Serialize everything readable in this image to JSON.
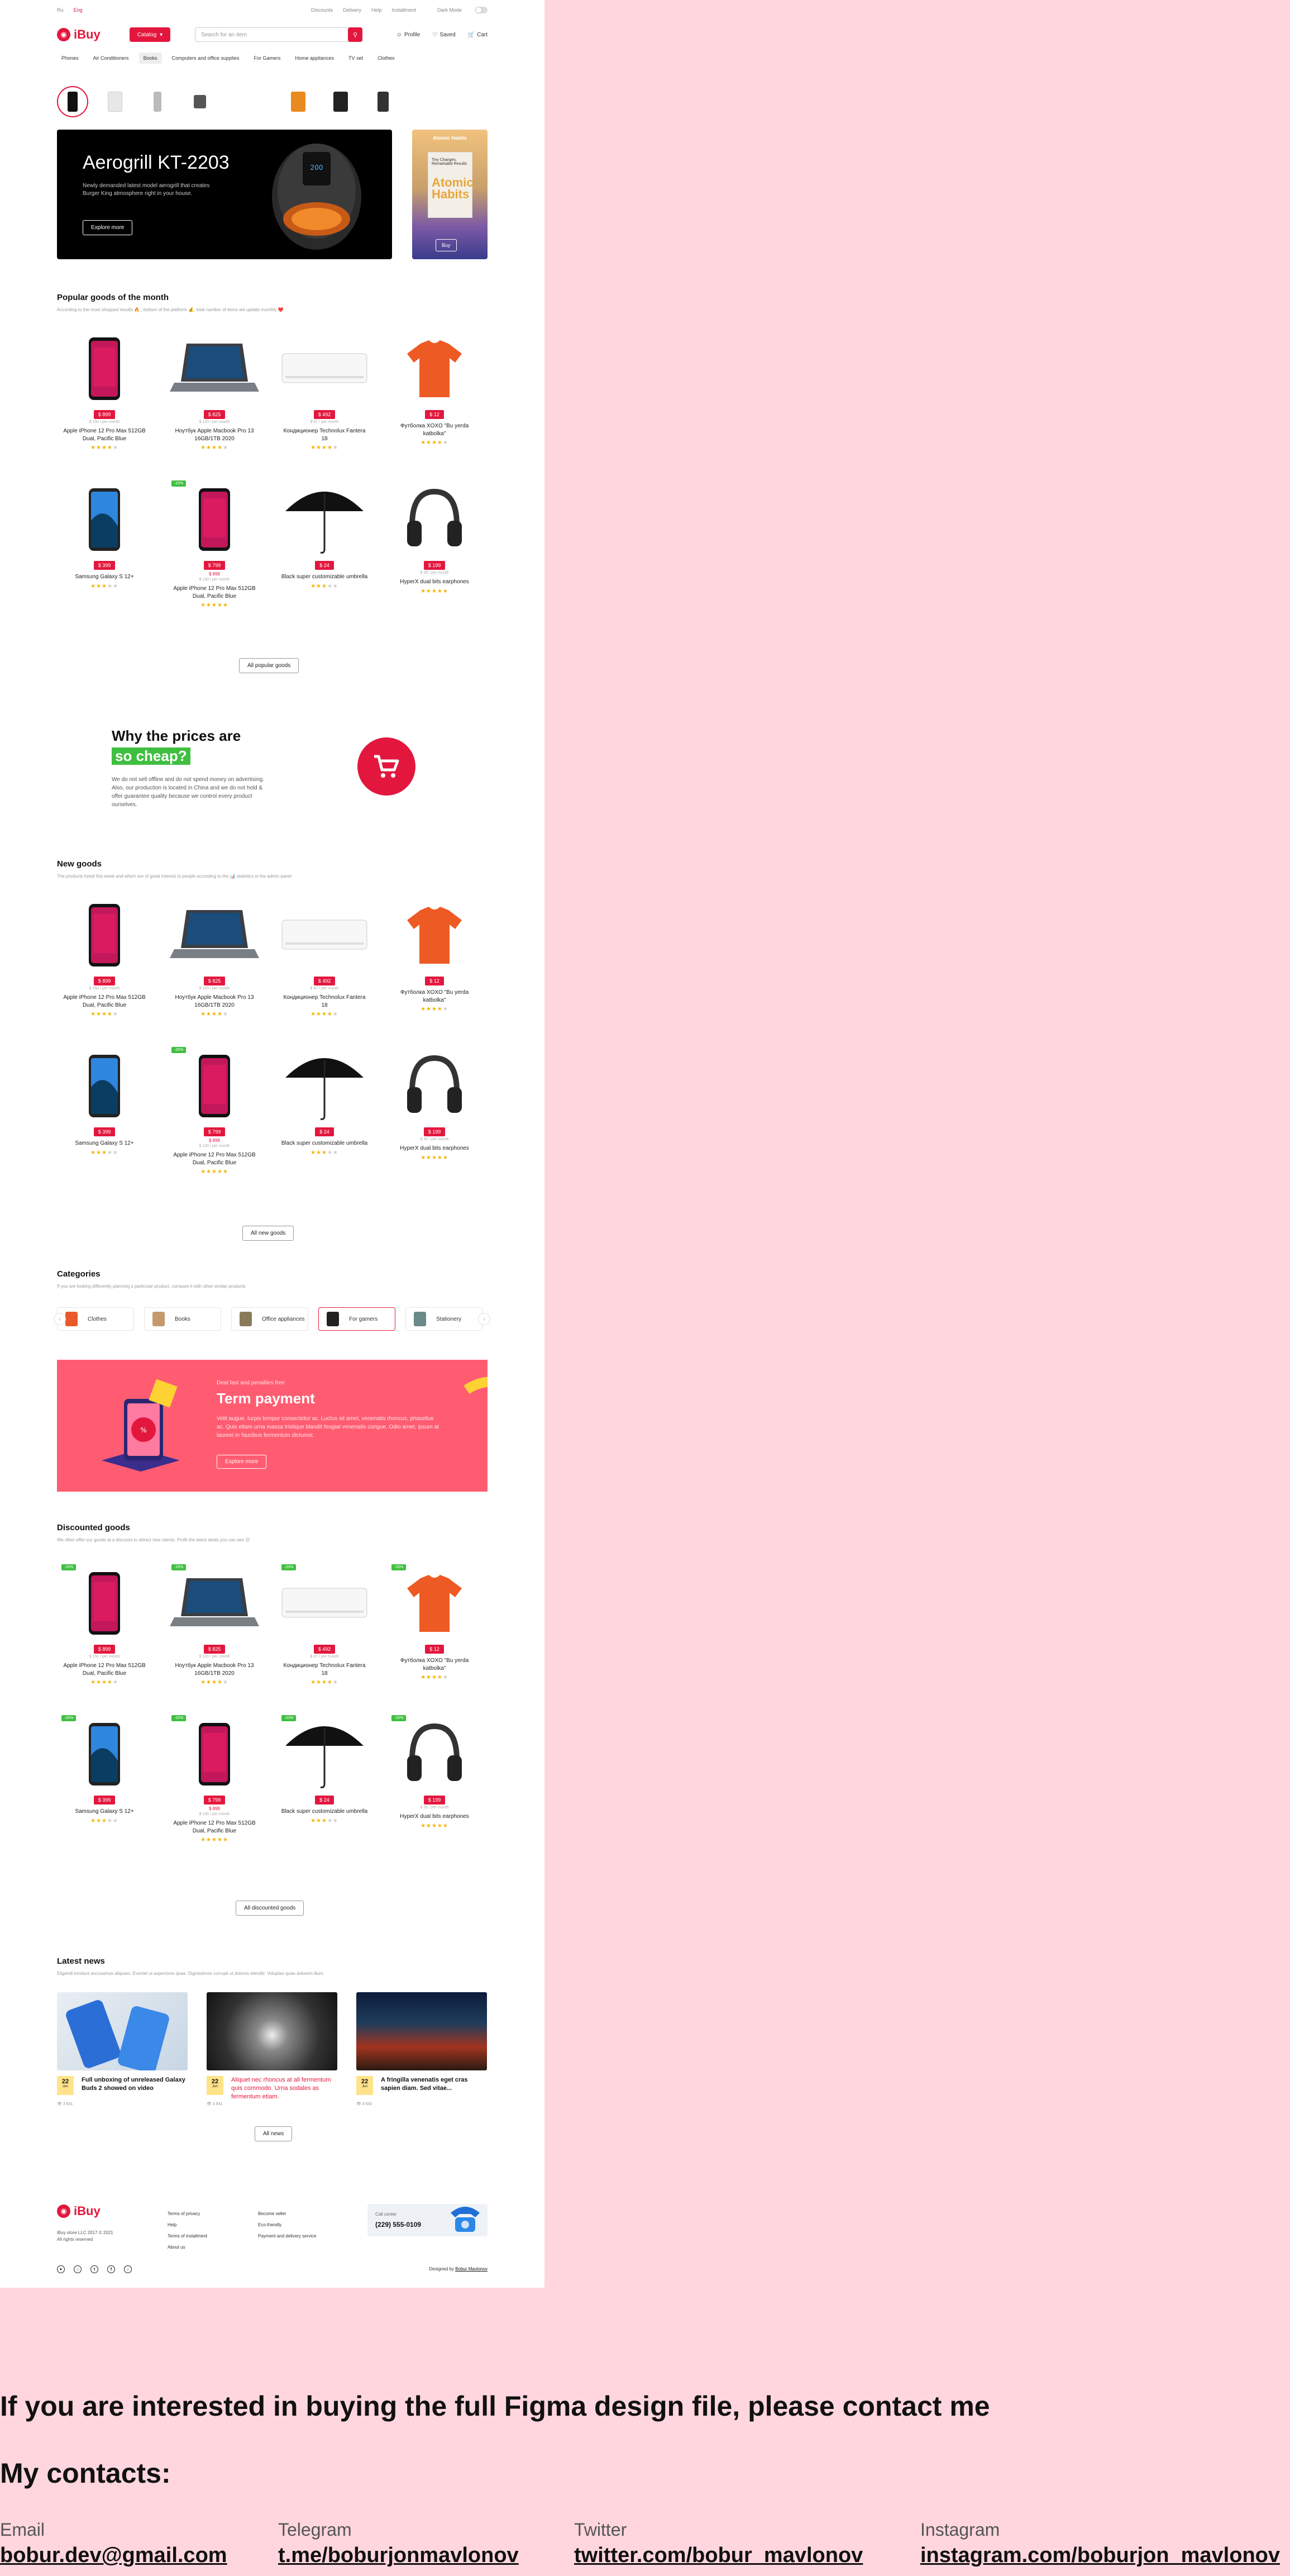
{
  "topbar": {
    "lang_ru": "Ru",
    "lang_eng": "Eng",
    "links": [
      "Discounts",
      "Delivery",
      "Help",
      "Installment"
    ],
    "dark_mode": "Dark Mode"
  },
  "header": {
    "logo": "iBuy",
    "catalog": "Catalog",
    "search_placeholder": "Search for an item",
    "profile": "Profile",
    "saved": "Saved",
    "cart": "Cart"
  },
  "nav": [
    "Phones",
    "Air Conditioners",
    "Books",
    "Computers and office supplies",
    "For Gamers",
    "Home appliances",
    "TV set",
    "Clothes"
  ],
  "hero": {
    "title": "Aerogrill KT-2203",
    "text": "Newly demanded latest model aerogrill that creates Burger King atmosphere right in your house.",
    "button": "Explore more"
  },
  "book_ad": {
    "title": "Atomic Habits",
    "cover_small": "Tiny Changes, Remarkable Results",
    "cover_title": "Atomic Habits",
    "button": "Buy"
  },
  "popular": {
    "title": "Popular goods of the month",
    "subtitle": "According to the most shopped results 🔥 , bottom of the platform 💰, total number of items we update monthly ❤️",
    "button": "All popular goods"
  },
  "why": {
    "title": "Why the prices are",
    "highlight": "so cheap?",
    "text": "We do not sell offline and do not spend money on advertising. Also, our production is located in China and we do not hold & offer guarantee quality because we control every product ourselves."
  },
  "new_goods": {
    "title": "New goods",
    "subtitle": "The products listed this week and which are of great interest to people according to the 📊 statistics in the admin panel",
    "button": "All new goods"
  },
  "categories": {
    "title": "Categories",
    "subtitle": "If you are looking differently planning a particular product, compare it with other similar products",
    "items": [
      "Clothes",
      "Books",
      "Office appliances",
      "For gamers",
      "Stationery"
    ]
  },
  "term": {
    "small": "Deal fast and penalties free",
    "title": "Term payment",
    "text": "Velit augue, turpis tempor consectetur ac. Luctus sit amet, venenatis rhoncus, phasellus ac. Quis etiam urna massa tristique blandit feugiat venenatis congue. Odio amet, ipsum at laoreet in faucibus fermentum dictumst.",
    "button": "Explore more"
  },
  "discounted": {
    "title": "Discounted goods",
    "subtitle": "We often offer our goods at a discount to attract new clients. Profit the latest deals you can see 😊",
    "button": "All discounted goods"
  },
  "products": [
    {
      "name": "Apple iPhone 12 Pro Max 512GB Dual, Pacific Blue",
      "price": "$ 899",
      "installment": "$ 150 / per month",
      "rating": 4
    },
    {
      "name": "Ноутбук Apple Macbook Pro 13 16GB/1TB 2020",
      "price": "$ 825",
      "installment": "$ 120 / per month",
      "rating": 4
    },
    {
      "name": "Кондиционер Technolux Fantera 18",
      "price": "$ 492",
      "installment": "$ 87 / per month",
      "rating": 4
    },
    {
      "name": "Футболка XOXO \"Bu yerda katbolka\"",
      "price": "$ 12",
      "installment": "",
      "rating": 4
    },
    {
      "name": "Samsung Galaxy S 12+",
      "price": "$ 399",
      "installment": "",
      "rating": 3
    },
    {
      "name": "Apple iPhone 12 Pro Max 512GB Dual, Pacific Blue",
      "price": "$ 799",
      "old": "$ 899",
      "installment": "$ 130 / per month",
      "rating": 5
    },
    {
      "name": "Black super customizable umbrella",
      "price": "$ 24",
      "installment": "",
      "rating": 3
    },
    {
      "name": "HyperX dual bits earphones",
      "price": "$ 199",
      "installment": "$ 35 / per month",
      "rating": 5
    }
  ],
  "badge_label": "-20%",
  "news": {
    "title": "Latest news",
    "subtitle": "Eligendi incidunt accusamus aliquam. Eveniet ut asperiores quas. Dignissimos corrupti ut dolores elenditi. Voluptas quae dolorem illum.",
    "button": "All news",
    "items": [
      {
        "day": "22",
        "month": "Jun",
        "title": "Full unboxing of unreleased Galaxy Buds 2 showed on video",
        "views": "3 541"
      },
      {
        "day": "22",
        "month": "Jun",
        "title": "Aliquet nec rhoncus at all fermentum quis commodo. Urna sodales as fermentum etiam.",
        "views": "3 541"
      },
      {
        "day": "22",
        "month": "Jun",
        "title": "A fringilla venenatis eget cras sapien diam. Sed vitae...",
        "views": "3 541"
      }
    ]
  },
  "footer": {
    "logo": "iBuy",
    "desc1": "iBuy store LLC 2017 © 2021",
    "desc2": "All rights reserved",
    "col1": [
      "Terms of privacy",
      "Help",
      "Terms of installment",
      "About us"
    ],
    "col2": [
      "Become seller",
      "Eco-friendly",
      "Payment and delivery service"
    ],
    "call_label": "Call center",
    "phone": "(229) 555-0109",
    "designed_prefix": "Designed by",
    "designer": "Bobur Mavlonov"
  },
  "pitch": "If you are interested in buying the full Figma design file, please contact me",
  "my_contacts": "My contacts:",
  "contacts": [
    {
      "label": "Email",
      "value": "bobur.dev@gmail.com"
    },
    {
      "label": "Telegram",
      "value": "t.me/boburjonmavlonov"
    },
    {
      "label": "Twitter",
      "value": "twitter.com/bobur_mavlonov"
    },
    {
      "label": "Instagram",
      "value": "instagram.com/boburjon_mavlonov"
    }
  ],
  "colors": {
    "accent": "#e3173e",
    "green": "#3fbf3f",
    "promo": "#ff5c72",
    "page_bg": "#ffd6dd"
  }
}
